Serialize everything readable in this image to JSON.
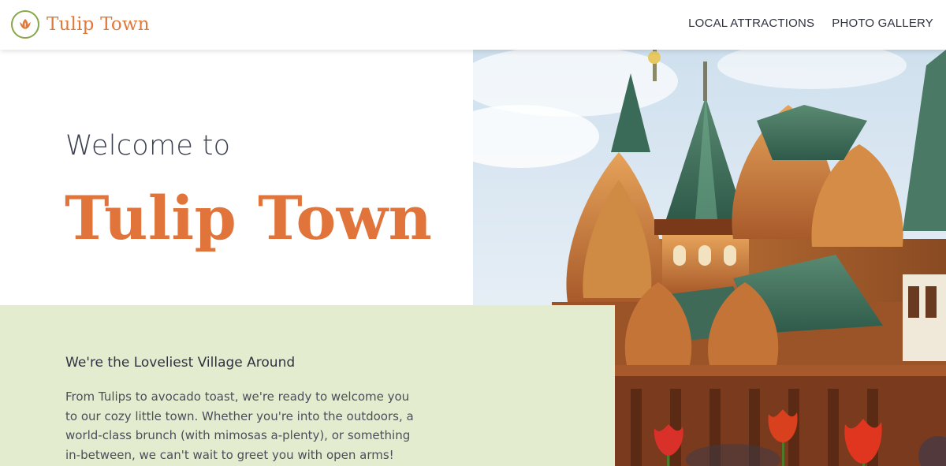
{
  "header": {
    "brand_name": "Tulip Town",
    "logo_icon": "tulip-icon",
    "nav": [
      {
        "label": "LOCAL ATTRACTIONS"
      },
      {
        "label": "PHOTO GALLERY"
      }
    ]
  },
  "hero": {
    "welcome_pre": "Welcome to",
    "welcome_title": "Tulip Town",
    "image_subject": "wooden-palace-with-tulips"
  },
  "info": {
    "heading": "We're the Loveliest Village Around",
    "body": "From Tulips to avocado toast, we're ready to welcome you to our cozy little town. Whether you're into the outdoors, a world-class brunch (with mimosas a-plenty), or something in-between, we can't wait to greet you with open arms!"
  },
  "colors": {
    "accent": "#e0743a",
    "logo_ring": "#8aa64a",
    "panel": "#e4ecd0",
    "text": "#3a3f4a"
  }
}
